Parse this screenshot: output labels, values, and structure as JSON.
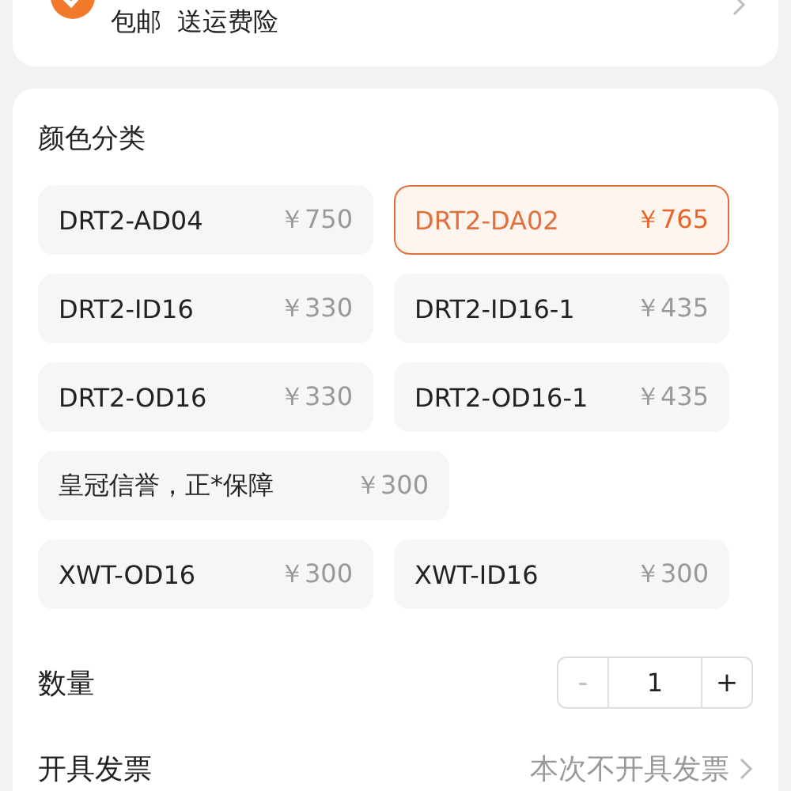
{
  "shipping": {
    "text": "包邮  送运费险"
  },
  "variants": {
    "title": "颜色分类",
    "options": [
      {
        "name": "DRT2-AD04",
        "price": "￥750",
        "selected": false,
        "wide": false
      },
      {
        "name": "DRT2-DA02",
        "price": "￥765",
        "selected": true,
        "wide": false
      },
      {
        "name": "DRT2-ID16",
        "price": "￥330",
        "selected": false,
        "wide": false
      },
      {
        "name": "DRT2-ID16-1",
        "price": "￥435",
        "selected": false,
        "wide": false
      },
      {
        "name": "DRT2-OD16",
        "price": "￥330",
        "selected": false,
        "wide": false
      },
      {
        "name": "DRT2-OD16-1",
        "price": "￥435",
        "selected": false,
        "wide": false
      },
      {
        "name": "皇冠信誉，正*保障",
        "price": "￥300",
        "selected": false,
        "wide": true
      },
      {
        "name": "XWT-OD16",
        "price": "￥300",
        "selected": false,
        "wide": false
      },
      {
        "name": "XWT-ID16",
        "price": "￥300",
        "selected": false,
        "wide": false
      }
    ]
  },
  "quantity": {
    "label": "数量",
    "minus": "-",
    "value": "1",
    "plus": "+",
    "minus_disabled": true
  },
  "invoice": {
    "label": "开具发票",
    "value": "本次不开具发票"
  }
}
